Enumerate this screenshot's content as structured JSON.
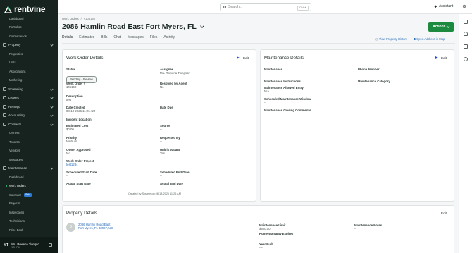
{
  "app": {
    "logo_text": "rentvine"
  },
  "sidebar": {
    "items": [
      {
        "label": "Dashboard",
        "type": "sub"
      },
      {
        "label": "Portfolios",
        "type": "sub"
      },
      {
        "label": "Owner Leads",
        "type": "sub"
      },
      {
        "label": "Property",
        "type": "group"
      },
      {
        "label": "Properties",
        "type": "sub"
      },
      {
        "label": "Units",
        "type": "sub"
      },
      {
        "label": "Associations",
        "type": "sub"
      },
      {
        "label": "Marketing",
        "type": "sub"
      },
      {
        "label": "Screening",
        "type": "group"
      },
      {
        "label": "Leases",
        "type": "group"
      },
      {
        "label": "Rentvgo",
        "type": "group"
      },
      {
        "label": "Accounting",
        "type": "group"
      },
      {
        "label": "Contacts",
        "type": "group"
      },
      {
        "label": "Owners",
        "type": "sub"
      },
      {
        "label": "Tenants",
        "type": "sub"
      },
      {
        "label": "Vendors",
        "type": "sub"
      },
      {
        "label": "Messages",
        "type": "sub"
      },
      {
        "label": "Maintenance",
        "type": "group"
      },
      {
        "label": "Dashboard",
        "type": "sub"
      },
      {
        "label": "Work Orders",
        "type": "sub",
        "active": true
      },
      {
        "label": "Calendar",
        "type": "sub",
        "badge": "Beta"
      },
      {
        "label": "Projects",
        "type": "sub"
      },
      {
        "label": "Inspections",
        "type": "sub"
      },
      {
        "label": "Technicians",
        "type": "sub"
      },
      {
        "label": "Price Book",
        "type": "sub"
      }
    ],
    "user": {
      "initials": "MT",
      "name": "Ma. Rowena Tiongsc",
      "sub": "122 PM"
    }
  },
  "topbar": {
    "search_placeholder": "Search...",
    "shortcut": "Ctrl+K",
    "assistant_label": "Assistant"
  },
  "header": {
    "breadcrumb_root": "Work Orders",
    "breadcrumb_sep": "/",
    "breadcrumb_id": "#106160",
    "title": "2086 Hamlin Road East Fort Myers, FL",
    "actions_label": "Actions"
  },
  "tabs": [
    "Details",
    "Estimates",
    "Bills",
    "Chat",
    "Messages",
    "Files",
    "Activity"
  ],
  "tab_links": {
    "view_history": "View Property History",
    "open_map": "Open Address in Map"
  },
  "work_order_details": {
    "title": "Work Order Details",
    "edit_label": "Edit",
    "status_label": "Status",
    "status_value": "Pending - Review",
    "assignee_label": "Assignee",
    "assignee_value": "Ma. Rowena Tiongson",
    "wo_number_label": "Work Order #",
    "wo_number_value": "106160",
    "resolved_label": "Resolved by Agent",
    "resolved_value": "No",
    "description_label": "Description",
    "description_value": "test",
    "date_created_label": "Date Created",
    "date_created_value": "08-13-2026 11:26 AM",
    "date_due_label": "Date Due",
    "date_due_value": "--",
    "incident_label": "Incident Location",
    "est_cost_label": "Estimated Cost",
    "est_cost_value": "$0.00",
    "source_label": "Source",
    "source_value": "--",
    "priority_label": "Priority",
    "priority_value": "Medium",
    "requested_label": "Requested By",
    "requested_value": "--",
    "owner_approved_label": "Owner Approved",
    "owner_approved_value": "No",
    "vacant_label": "Unit is Vacant",
    "vacant_value": "Yes",
    "project_label": "Work Order Project",
    "project_value": "test1234",
    "sched_start_label": "Scheduled Start Date",
    "sched_start_value": "--",
    "sched_end_label": "Scheduled End Date",
    "sched_end_value": "--",
    "actual_start_label": "Actual Start Date",
    "actual_start_value": "--",
    "actual_end_label": "Actual End Date",
    "actual_end_value": "--",
    "created_by": "Created by System on 08-13-2026 11:26 AM"
  },
  "maintenance_details": {
    "title": "Maintenance Details",
    "edit_label": "Edit",
    "maintenance_label": "Maintenance",
    "maintenance_value": "--",
    "phone_label": "Phone Number",
    "phone_value": "--",
    "instructions_label": "Maintenance Instructions",
    "category_label": "Maintenance Category",
    "allowed_entry_label": "Maintenance Allowed Entry",
    "allowed_entry_value": "N/A",
    "window_label": "Scheduled Maintenance Window",
    "window_value": "--",
    "closing_label": "Maintenance Closing Comments"
  },
  "property_details": {
    "title": "Property Details",
    "edit_label": "Edit",
    "avatar_letter": "P",
    "address_line1": "2086 Hamlin Road East",
    "address_line2": "Fort Myers, FL 33967, US",
    "limit_label": "Maintenance Limit",
    "limit_value": "$500.00",
    "warranty_label": "Home Warranty Expires",
    "warranty_value": "--",
    "year_label": "Year Built",
    "year_value": "----",
    "notes_label": "Maintenance Notes",
    "notes_value": "--"
  },
  "colors": {
    "sidebar_bg": "#16231f",
    "accent_green": "#1c8b3f",
    "link_blue": "#2e6fb8",
    "arrow_blue": "#1f4fd8"
  }
}
